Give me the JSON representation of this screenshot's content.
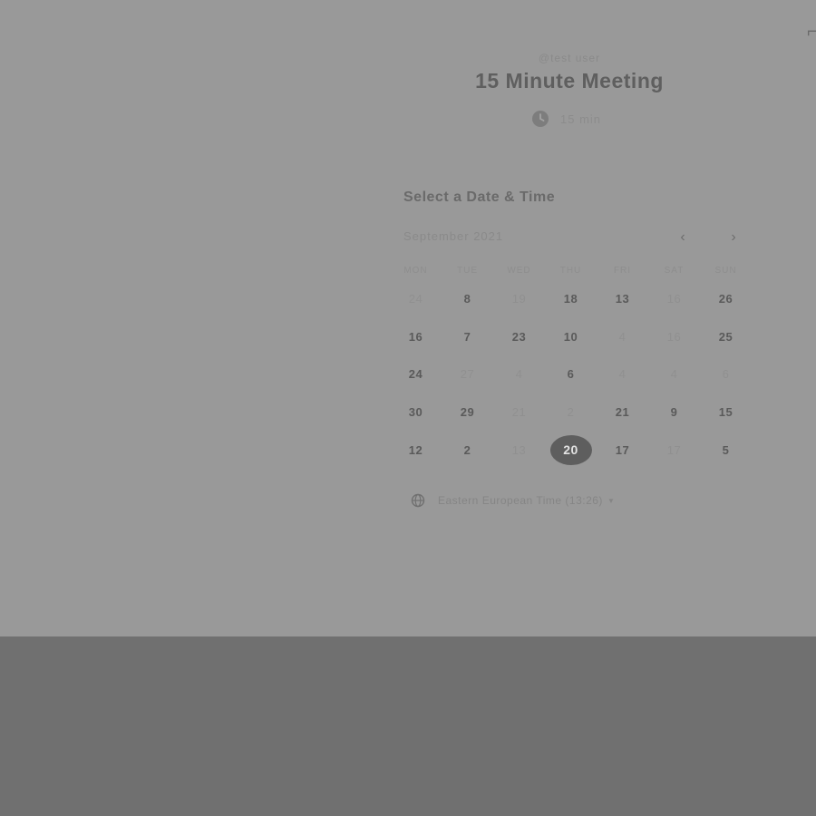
{
  "header": {
    "owner": "@test user",
    "event_title": "15 Minute Meeting",
    "duration": "15 min",
    "duration_icon": "clock-icon"
  },
  "booking": {
    "heading": "Select a Date & Time",
    "month": "September 2021",
    "prev_icon": "chevron-left-icon",
    "prev_label": "‹",
    "next_icon": "chevron-right-icon",
    "next_label": "›",
    "weekdays": [
      "MON",
      "TUE",
      "WED",
      "THU",
      "FRI",
      "SAT",
      "SUN"
    ],
    "days": [
      {
        "label": "24",
        "available": false,
        "selected": false
      },
      {
        "label": "8",
        "available": true,
        "selected": false
      },
      {
        "label": "19",
        "available": false,
        "selected": false
      },
      {
        "label": "18",
        "available": true,
        "selected": false
      },
      {
        "label": "13",
        "available": true,
        "selected": false
      },
      {
        "label": "16",
        "available": false,
        "selected": false
      },
      {
        "label": "26",
        "available": true,
        "selected": false
      },
      {
        "label": "16",
        "available": true,
        "selected": false
      },
      {
        "label": "7",
        "available": true,
        "selected": false
      },
      {
        "label": "23",
        "available": true,
        "selected": false
      },
      {
        "label": "10",
        "available": true,
        "selected": false
      },
      {
        "label": "4",
        "available": false,
        "selected": false
      },
      {
        "label": "16",
        "available": false,
        "selected": false
      },
      {
        "label": "25",
        "available": true,
        "selected": false
      },
      {
        "label": "24",
        "available": true,
        "selected": false
      },
      {
        "label": "27",
        "available": false,
        "selected": false
      },
      {
        "label": "4",
        "available": false,
        "selected": false
      },
      {
        "label": "6",
        "available": true,
        "selected": false
      },
      {
        "label": "4",
        "available": false,
        "selected": false
      },
      {
        "label": "4",
        "available": false,
        "selected": false
      },
      {
        "label": "6",
        "available": false,
        "selected": false
      },
      {
        "label": "30",
        "available": true,
        "selected": false
      },
      {
        "label": "29",
        "available": true,
        "selected": false
      },
      {
        "label": "21",
        "available": false,
        "selected": false
      },
      {
        "label": "2",
        "available": false,
        "selected": false
      },
      {
        "label": "21",
        "available": true,
        "selected": false
      },
      {
        "label": "9",
        "available": true,
        "selected": false
      },
      {
        "label": "15",
        "available": true,
        "selected": false
      },
      {
        "label": "12",
        "available": true,
        "selected": false
      },
      {
        "label": "2",
        "available": true,
        "selected": false
      },
      {
        "label": "13",
        "available": false,
        "selected": false
      },
      {
        "label": "20",
        "available": true,
        "selected": true
      },
      {
        "label": "17",
        "available": true,
        "selected": false
      },
      {
        "label": "17",
        "available": false,
        "selected": false
      },
      {
        "label": "5",
        "available": true,
        "selected": false
      }
    ],
    "timezone": "Eastern European Time (13:26)",
    "timezone_icon": "globe-icon"
  },
  "colors": {
    "card_background": "#999999",
    "page_background": "#707070",
    "selected_day": "#5e5e5e"
  }
}
